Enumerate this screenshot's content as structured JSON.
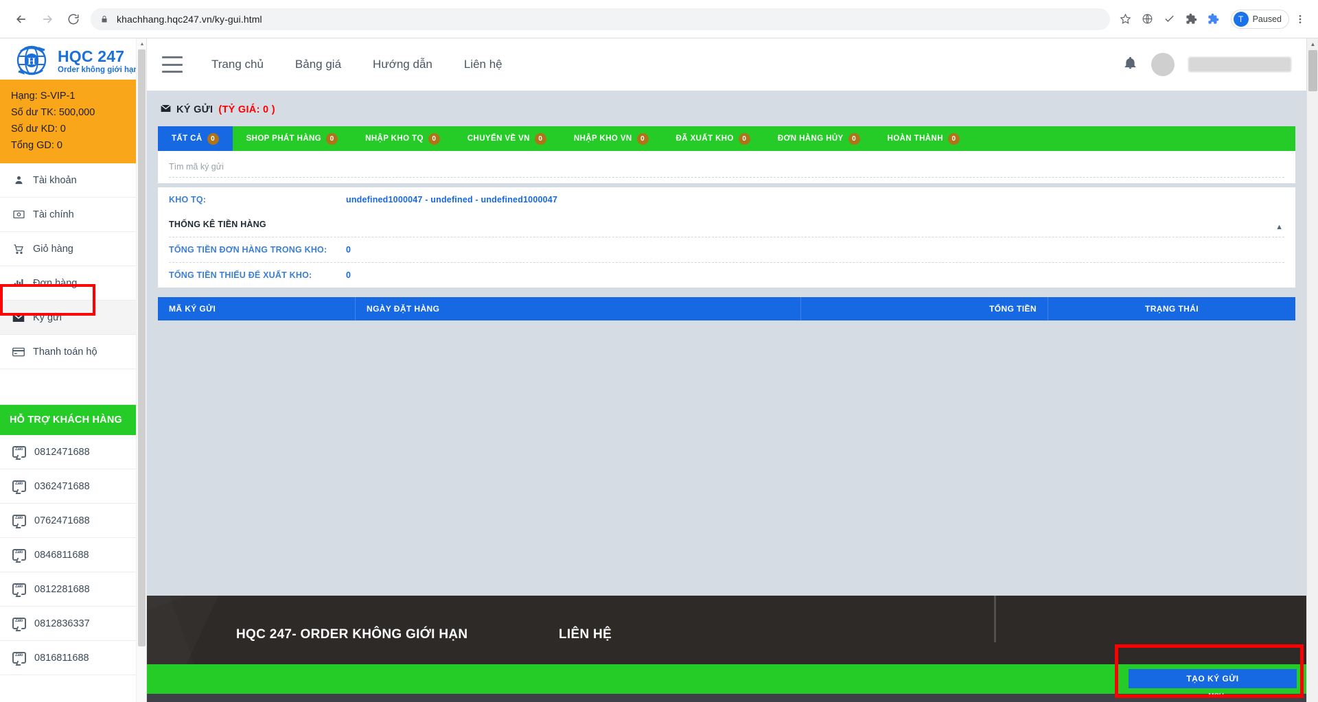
{
  "browser": {
    "url_text": "khachhang.hqc247.vn/ky-gui.html",
    "back_icon": "back-arrow-icon",
    "forward_icon": "forward-arrow-icon",
    "reload_icon": "reload-icon",
    "lock_icon": "lock-icon",
    "star_icon": "bookmark-star-icon",
    "profile_initial": "T",
    "paused_label": "Paused",
    "menu_icon": "three-dots-menu-icon"
  },
  "brand": {
    "name": "HQC 247",
    "tagline": "Order không giới hạn"
  },
  "account": {
    "rank": "Hạng: S-VIP-1",
    "balance_tk": "Số dư TK: 500,000",
    "balance_kd": "Số dư KD: 0",
    "total_gd": "Tổng GD: 0"
  },
  "sidebar": {
    "items": [
      {
        "label": "Tài khoản",
        "icon": "user-icon",
        "active": false
      },
      {
        "label": "Tài chính",
        "icon": "money-bill-icon",
        "active": false
      },
      {
        "label": "Giỏ hàng",
        "icon": "shopping-cart-icon",
        "active": false
      },
      {
        "label": "Đơn hàng",
        "icon": "bar-chart-icon",
        "active": false
      },
      {
        "label": "Ký gửi",
        "icon": "envelope-icon",
        "active": true
      },
      {
        "label": "Thanh toán hộ",
        "icon": "credit-card-icon",
        "active": false
      }
    ],
    "support_title": "HỖ TRỢ KHÁCH HÀNG",
    "phones": [
      "0812471688",
      "0362471688",
      "0762471688",
      "0846811688",
      "0812281688",
      "0812836337",
      "0816811688"
    ]
  },
  "topnav": {
    "menu_icon": "hamburger-menu-icon",
    "links": [
      "Trang chủ",
      "Bảng giá",
      "Hướng dẫn",
      "Liên hệ"
    ],
    "bell_icon": "notification-bell-icon",
    "avatar": "user-avatar"
  },
  "page": {
    "title_icon": "envelope-icon",
    "title": "KÝ GỬI",
    "rate_label": "(TỶ GIÁ: 0 )"
  },
  "tabs": [
    {
      "label": "TẤT CẢ",
      "count": "0",
      "active": true
    },
    {
      "label": "SHOP PHÁT HÀNG",
      "count": "0",
      "active": false
    },
    {
      "label": "NHẬP KHO TQ",
      "count": "0",
      "active": false
    },
    {
      "label": "CHUYỂN VỀ VN",
      "count": "0",
      "active": false
    },
    {
      "label": "NHẬP KHO VN",
      "count": "0",
      "active": false
    },
    {
      "label": "ĐÃ XUẤT KHO",
      "count": "0",
      "active": false
    },
    {
      "label": "ĐƠN HÀNG HỦY",
      "count": "0",
      "active": false
    },
    {
      "label": "HOÀN THÀNH",
      "count": "0",
      "active": false
    }
  ],
  "search": {
    "placeholder": "Tìm mã ký gửi",
    "value": ""
  },
  "info": {
    "warehouse_label": "KHO TQ:",
    "warehouse_value": "undefined1000047 - undefined - undefined1000047",
    "section_title": "THỐNG KÊ TIỀN HÀNG",
    "stats": [
      {
        "label": "TỔNG TIỀN ĐƠN HÀNG TRONG KHO:",
        "value": "0"
      },
      {
        "label": "TỔNG TIỀN THIẾU ĐỂ XUẤT KHO:",
        "value": "0"
      }
    ],
    "collapse_icon": "caret-up-icon"
  },
  "table": {
    "columns": [
      "MÃ KÝ GỬI",
      "NGÀY ĐẶT HÀNG",
      "TỔNG TIỀN",
      "TRẠNG THÁI"
    ],
    "rows": []
  },
  "footer": {
    "brand_line": "HQC 247- ORDER KHÔNG GIỚI HẠN",
    "contact_label": "LIÊN HỆ",
    "cta_label": "TẠO KÝ GỬI",
    "status_text": "MCH"
  },
  "colors": {
    "green": "#25cc27",
    "blue": "#1668e3",
    "orange": "#f9a61a",
    "red_highlight": "#ff0000",
    "badge_brown": "#b07418"
  }
}
